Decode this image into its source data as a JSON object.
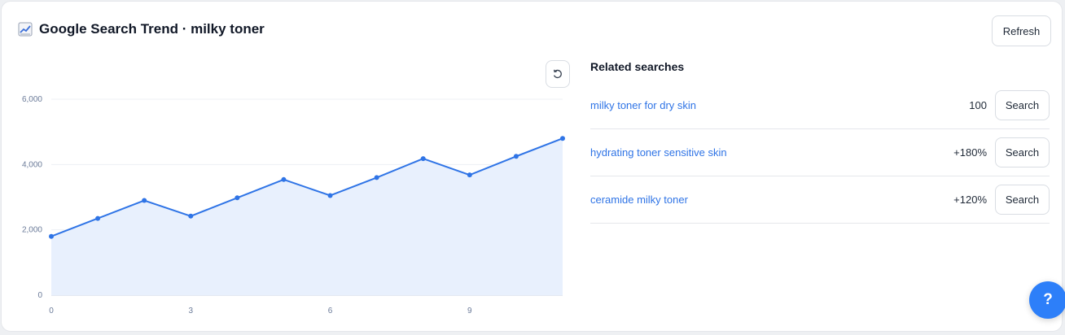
{
  "header": {
    "title": "Google Search Trend · milky toner",
    "refresh_label": "Refresh"
  },
  "related": {
    "title": "Related searches",
    "items": [
      {
        "term": "milky toner for dry skin",
        "value": "100",
        "button": "Search"
      },
      {
        "term": "hydrating toner sensitive skin",
        "value": "+180%",
        "button": "Search"
      },
      {
        "term": "ceramide milky toner",
        "value": "+120%",
        "button": "Search"
      }
    ]
  },
  "help_label": "?",
  "colors": {
    "line": "#2f74e6",
    "area": "#e8f0fd",
    "link": "#2f74e6",
    "help": "#2d7ff9"
  },
  "icons": {
    "title_icon": "chart-increasing-icon",
    "reset_icon": "rotate-ccw-icon"
  },
  "chart_data": {
    "type": "area",
    "x": [
      0,
      1,
      2,
      3,
      4,
      5,
      6,
      7,
      8,
      9,
      10,
      11
    ],
    "y": [
      1800,
      2350,
      2900,
      2420,
      2980,
      3540,
      3050,
      3600,
      4180,
      3680,
      4250,
      4800
    ],
    "xlim": [
      0,
      11
    ],
    "ylim": [
      0,
      6000
    ],
    "x_ticks": [
      0,
      3,
      6,
      9
    ],
    "y_ticks": [
      0,
      2000,
      4000,
      6000
    ],
    "y_tick_labels": [
      "0",
      "2,000",
      "4,000",
      "6,000"
    ],
    "grid": true,
    "title": "",
    "xlabel": "",
    "ylabel": ""
  }
}
